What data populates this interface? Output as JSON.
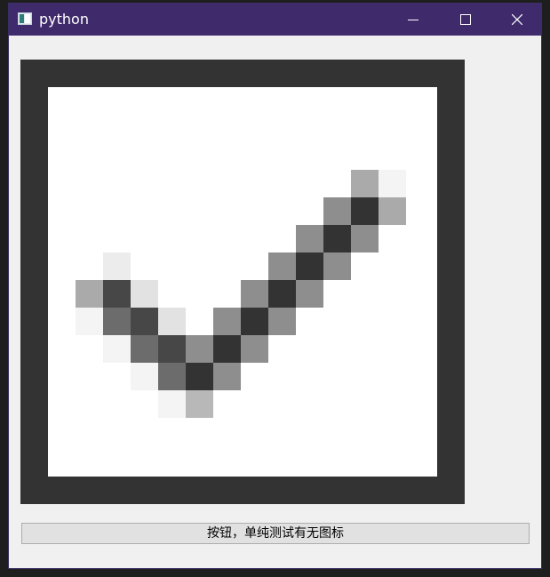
{
  "window": {
    "title": "python",
    "titlebar_color": "#3f2b6b",
    "controls": {
      "minimize_icon": "minimize-icon",
      "maximize_icon": "maximize-icon",
      "close_icon": "close-icon"
    }
  },
  "content": {
    "icon_name": "checkmark-icon",
    "frame_color": "#333333",
    "button_label": "按钮，单纯测试有无图标"
  }
}
